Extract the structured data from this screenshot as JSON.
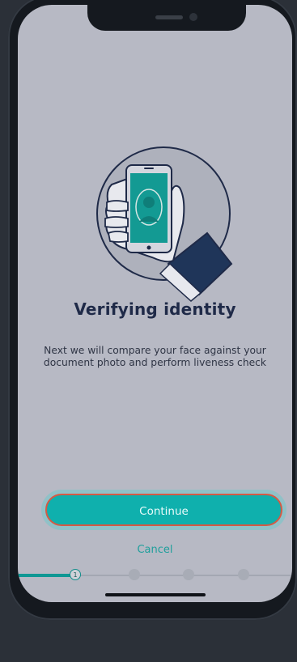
{
  "screen": {
    "title": "Verifying identity",
    "description": "Next we will compare your face against your document photo and perform liveness check"
  },
  "actions": {
    "continue_label": "Continue",
    "cancel_label": "Cancel"
  },
  "progress": {
    "steps": [
      "1",
      "2",
      "3",
      "4"
    ],
    "current_step": 1
  },
  "icons": {
    "illustration": "hand-holding-phone-face-illustration"
  },
  "colors": {
    "accent": "#0fb0ad",
    "title": "#1f2a48",
    "background": "#b7b9c4"
  }
}
